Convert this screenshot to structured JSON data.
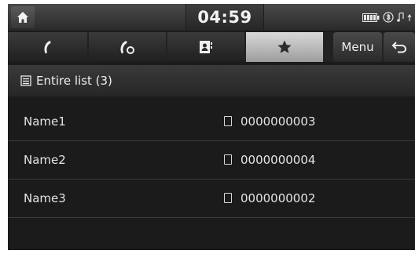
{
  "status_bar": {
    "time": "04:59",
    "icons": [
      "home-icon",
      "battery-icon",
      "bluetooth-icon",
      "signal-icon"
    ]
  },
  "tabs": [
    {
      "name": "call-history",
      "icon": "handset-icon"
    },
    {
      "name": "dial",
      "icon": "handset-dial-icon"
    },
    {
      "name": "contacts",
      "icon": "contacts-book-icon"
    },
    {
      "name": "favourites",
      "icon": "star-icon",
      "active": true
    }
  ],
  "menu": {
    "label": "Menu"
  },
  "back": {
    "icon": "back-arrow-icon"
  },
  "list": {
    "header_label": "Entire list (3)",
    "header_icon": "list-icon",
    "items": [
      {
        "name": "Name1",
        "number": "0000000003"
      },
      {
        "name": "Name2",
        "number": "0000000004"
      },
      {
        "name": "Name3",
        "number": "0000000002"
      }
    ]
  }
}
